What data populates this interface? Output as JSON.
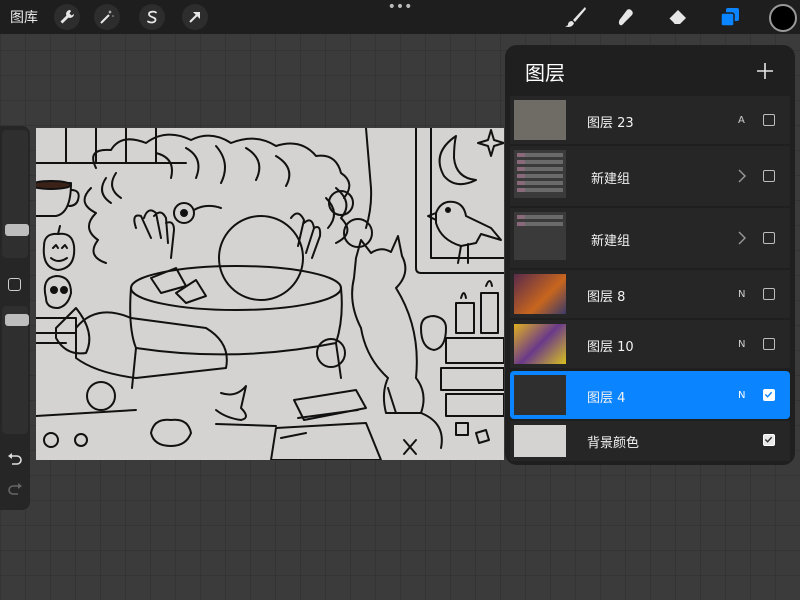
{
  "topbar": {
    "gallery_label": "图库",
    "tools_left": [
      "wrench-icon",
      "magic-wand-icon",
      "selection-s-icon",
      "transform-arrow-icon"
    ],
    "tools_right": [
      "brush-icon",
      "smudge-icon",
      "eraser-icon",
      "layers-icon"
    ],
    "active_tool": "layers-icon",
    "active_color": "#000000",
    "accent": "#0a84ff"
  },
  "layers": {
    "title": "图层",
    "items": [
      {
        "name": "图层 23",
        "mode": "A",
        "visible": false,
        "selected": false
      },
      {
        "name": "新建组",
        "mode": "",
        "group": true,
        "visible": false,
        "selected": false
      },
      {
        "name": "新建组",
        "mode": "",
        "group": true,
        "visible": false,
        "selected": false
      },
      {
        "name": "图层 8",
        "mode": "N",
        "visible": false,
        "selected": false
      },
      {
        "name": "图层 10",
        "mode": "N",
        "visible": false,
        "selected": false
      },
      {
        "name": "图层 4",
        "mode": "N",
        "visible": true,
        "selected": true
      },
      {
        "name": "背景颜色",
        "mode": "",
        "visible": true,
        "selected": false,
        "swatch": "#d4d3d1"
      }
    ]
  }
}
